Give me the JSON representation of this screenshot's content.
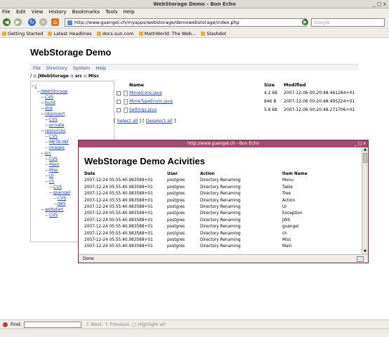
{
  "window": {
    "title": "WebStorage Demo - Bon Echo",
    "controls": "_ □ x"
  },
  "menubar": [
    "File",
    "Edit",
    "View",
    "History",
    "Bookmarks",
    "Tools",
    "Help"
  ],
  "navbar": {
    "url": "http://www.guengel.ch/myapps/webstorage/demowebstorage/index.php",
    "search_placeholder": "Google"
  },
  "bookmarks": [
    "Getting Started",
    "Latest Headlines",
    "docs.sun.com",
    "MathWorld: The Web...",
    "Slashdot"
  ],
  "page": {
    "title": "WebStorage Demo",
    "app_menu": [
      "File",
      "Directory",
      "System",
      "Help"
    ],
    "breadcrumb": "/ :: JWebStorage :: src :: Misc",
    "tree": [
      "/",
      "JWebStorage",
      "CVS",
      "build",
      "dist",
      "nbproject",
      "CVS",
      "private",
      "resources",
      "CVS",
      "META-INF",
      "images",
      "src",
      "CVS",
      "Main",
      "Misc",
      "UI",
      "ch",
      "CVS",
      "guengel",
      "CVS",
      "JWS",
      "webstart",
      "CVS"
    ],
    "file_headers": {
      "name": "Name",
      "size": "Size",
      "modified": "Modified"
    },
    "files": [
      {
        "name": "MimeIcons.java",
        "size": "4.2 kB",
        "modified": "2007-12-06 00:20:48.461284+01"
      },
      {
        "name": "MimeTypeEnum.java",
        "size": "846 B",
        "modified": "2007-12-06 00:20:48.495224+01"
      },
      {
        "name": "Settings.java",
        "size": "5.6 kB",
        "modified": "2007-12-06 00:20:48.271706+01"
      }
    ],
    "select_all": "Select all",
    "deselect_all": "Deselect all",
    "select_sep_open": "[",
    "select_sep_mid": "] [",
    "select_sep_close": "]"
  },
  "popup": {
    "title": "http://www.guengel.ch - Bon Echo",
    "controls": "_ □ x",
    "heading": "WebStorage Demo Acivities",
    "headers": {
      "date": "Date",
      "user": "User",
      "action": "Action",
      "item": "Item Name"
    },
    "rows": [
      {
        "date": "2007-12-24 05:55:40.983588+01",
        "user": "postgres",
        "action": "Directory Renaming",
        "item": "Menu"
      },
      {
        "date": "2007-12-24 05:55:40.983588+01",
        "user": "postgres",
        "action": "Directory Renaming",
        "item": "Table"
      },
      {
        "date": "2007-12-24 05:55:40.983588+01",
        "user": "postgres",
        "action": "Directory Renaming",
        "item": "Tree"
      },
      {
        "date": "2007-12-24 05:55:40.983588+01",
        "user": "postgres",
        "action": "Directory Renaming",
        "item": "Action"
      },
      {
        "date": "2007-12-24 05:55:40.983588+01",
        "user": "postgres",
        "action": "Directory Renaming",
        "item": "UI"
      },
      {
        "date": "2007-12-24 05:55:40.983588+01",
        "user": "postgres",
        "action": "Directory Renaming",
        "item": "Exception"
      },
      {
        "date": "2007-12-24 05:55:40.983588+01",
        "user": "postgres",
        "action": "Directory Renaming",
        "item": "JWS"
      },
      {
        "date": "2007-12-24 05:55:40.983588+01",
        "user": "postgres",
        "action": "Directory Renaming",
        "item": "guengel"
      },
      {
        "date": "2007-12-24 05:55:40.983588+01",
        "user": "postgres",
        "action": "Directory Renaming",
        "item": "ch"
      },
      {
        "date": "2007-12-24 05:55:40.983588+01",
        "user": "postgres",
        "action": "Directory Renaming",
        "item": "Misc"
      },
      {
        "date": "2007-12-24 05:55:40.983588+01",
        "user": "postgres",
        "action": "Directory Renaming",
        "item": "Main"
      }
    ],
    "status": "Done"
  },
  "findbar": {
    "label": "Find:",
    "next": "Next",
    "previous": "Previous",
    "highlight": "Highlight all"
  },
  "colors": {
    "popup_titlebar": "#a24b70",
    "link": "#1b3fa0"
  }
}
